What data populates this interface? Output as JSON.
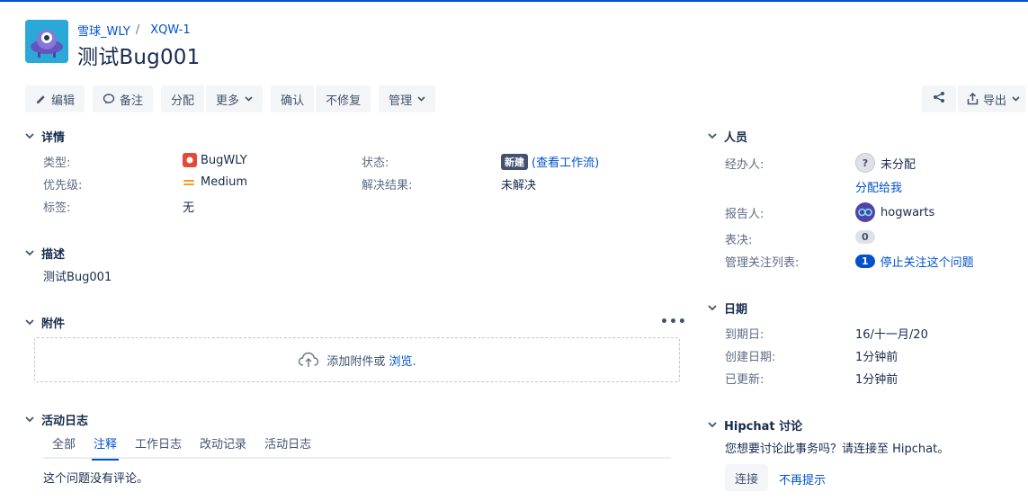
{
  "breadcrumb": {
    "project": "雪球_WLY",
    "separator": "/",
    "issue_key": "XQW-1"
  },
  "issue": {
    "title": "测试Bug001"
  },
  "toolbar": {
    "edit": "编辑",
    "comment": "备注",
    "assign": "分配",
    "more": "更多",
    "confirm": "确认",
    "wont_fix": "不修复",
    "manage": "管理",
    "export": "导出"
  },
  "details": {
    "heading": "详情",
    "type_label": "类型:",
    "type_value": "BugWLY",
    "priority_label": "优先级:",
    "priority_value": "Medium",
    "labels_label": "标签:",
    "labels_value": "无",
    "status_label": "状态:",
    "status_value": "新建",
    "status_workflow": "(查看工作流)",
    "resolution_label": "解决结果:",
    "resolution_value": "未解决"
  },
  "description": {
    "heading": "描述",
    "text": "测试Bug001"
  },
  "attachments": {
    "heading": "附件",
    "more": "•••",
    "drop_text": "添加附件或",
    "browse": "浏览."
  },
  "activity": {
    "heading": "活动日志",
    "tabs": [
      "全部",
      "注释",
      "工作日志",
      "改动记录",
      "活动日志"
    ],
    "active_tab": "注释",
    "empty_text": "这个问题没有评论。"
  },
  "people": {
    "heading": "人员",
    "assignee_label": "经办人:",
    "assignee_value": "未分配",
    "assign_to_me": "分配给我",
    "reporter_label": "报告人:",
    "reporter_value": "hogwarts",
    "votes_label": "表决:",
    "votes_value": "0",
    "watchers_label": "管理关注列表:",
    "watchers_count": "1",
    "watchers_action": "停止关注这个问题"
  },
  "dates": {
    "heading": "日期",
    "due_label": "到期日:",
    "due_value": "16/十一月/20",
    "created_label": "创建日期:",
    "created_value": "1分钟前",
    "updated_label": "已更新:",
    "updated_value": "1分钟前"
  },
  "hipchat": {
    "heading": "Hipchat 讨论",
    "prompt": "您想要讨论此事务吗？请连接至 Hipchat。",
    "connect": "连接",
    "dismiss": "不再提示"
  },
  "colors": {
    "accent": "#0052cc",
    "bug_red": "#e5493a",
    "priority_orange": "#ff991f",
    "lozenge": "#42526e"
  }
}
